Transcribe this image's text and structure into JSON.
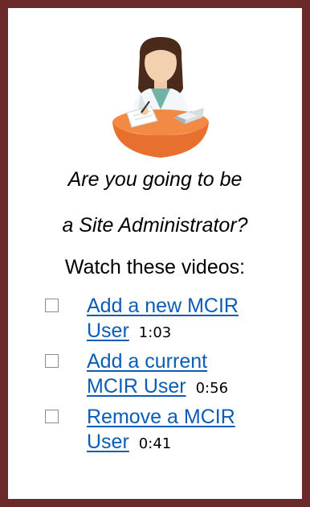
{
  "heading": {
    "line1": "Are you going to be",
    "line2": "a Site Administrator?",
    "line3": "Watch these videos:"
  },
  "videos": [
    {
      "title_line1": "Add a new MCIR",
      "title_line2": "User",
      "duration": "1:03"
    },
    {
      "title_line1": "Add a current",
      "title_line2": "MCIR User",
      "duration": "0:56"
    },
    {
      "title_line1": "Remove a MCIR",
      "title_line2": "User",
      "duration": "0:41"
    }
  ],
  "colors": {
    "frame": "#6b2a2a",
    "link": "#0b5db6",
    "illustration_desk": "#ee7b3a"
  },
  "icons": [
    "administrator-illustration",
    "checkbox-bullet-icon"
  ]
}
